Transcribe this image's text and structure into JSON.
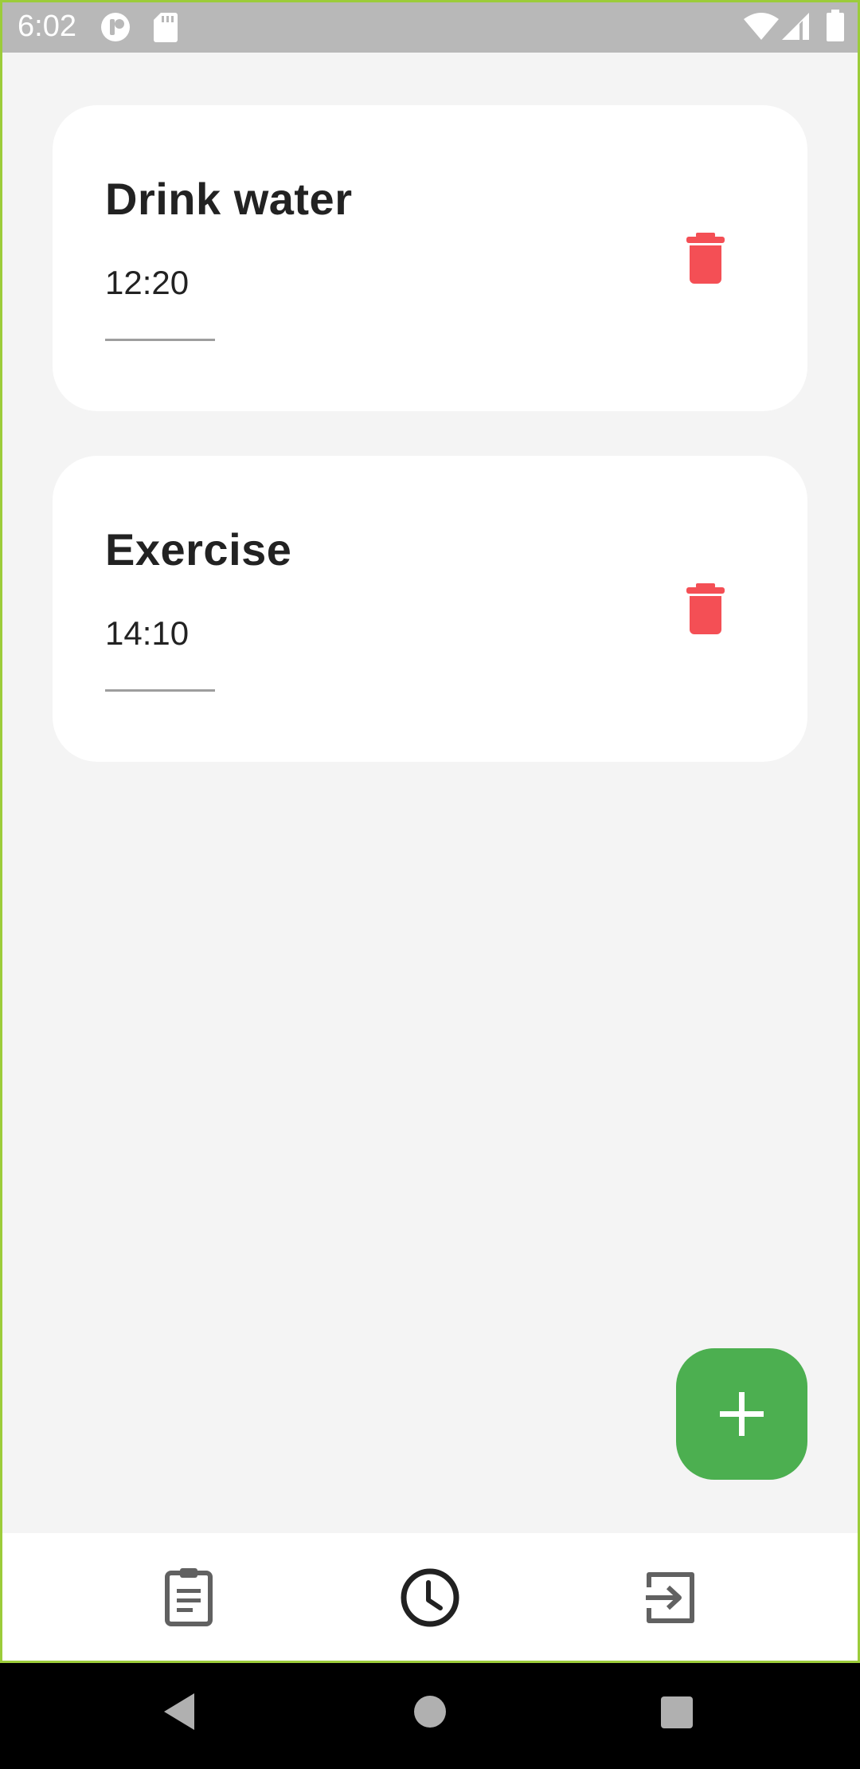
{
  "status_bar": {
    "time": "6:02",
    "icons": [
      "app-notification-icon",
      "sd-card-icon",
      "wifi-icon",
      "signal-icon",
      "battery-icon"
    ]
  },
  "reminders": [
    {
      "title": "Drink water",
      "time": "12:20",
      "delete_icon": "trash-icon"
    },
    {
      "title": "Exercise",
      "time": "14:10",
      "delete_icon": "trash-icon"
    }
  ],
  "fab": {
    "icon": "plus-icon"
  },
  "bottom_nav": {
    "items": [
      {
        "icon": "clipboard-icon",
        "selected": false
      },
      {
        "icon": "clock-icon",
        "selected": true
      },
      {
        "icon": "logout-icon",
        "selected": false
      }
    ]
  },
  "system_nav": {
    "icons": [
      "back-icon",
      "home-icon",
      "recents-icon"
    ]
  },
  "colors": {
    "background": "#f4f4f4",
    "card": "#ffffff",
    "accent_green": "#4caf50",
    "delete_red": "#f44f55",
    "status_bar": "#b8b8b8",
    "nav_icon": "#616161",
    "nav_icon_selected": "#212121"
  }
}
